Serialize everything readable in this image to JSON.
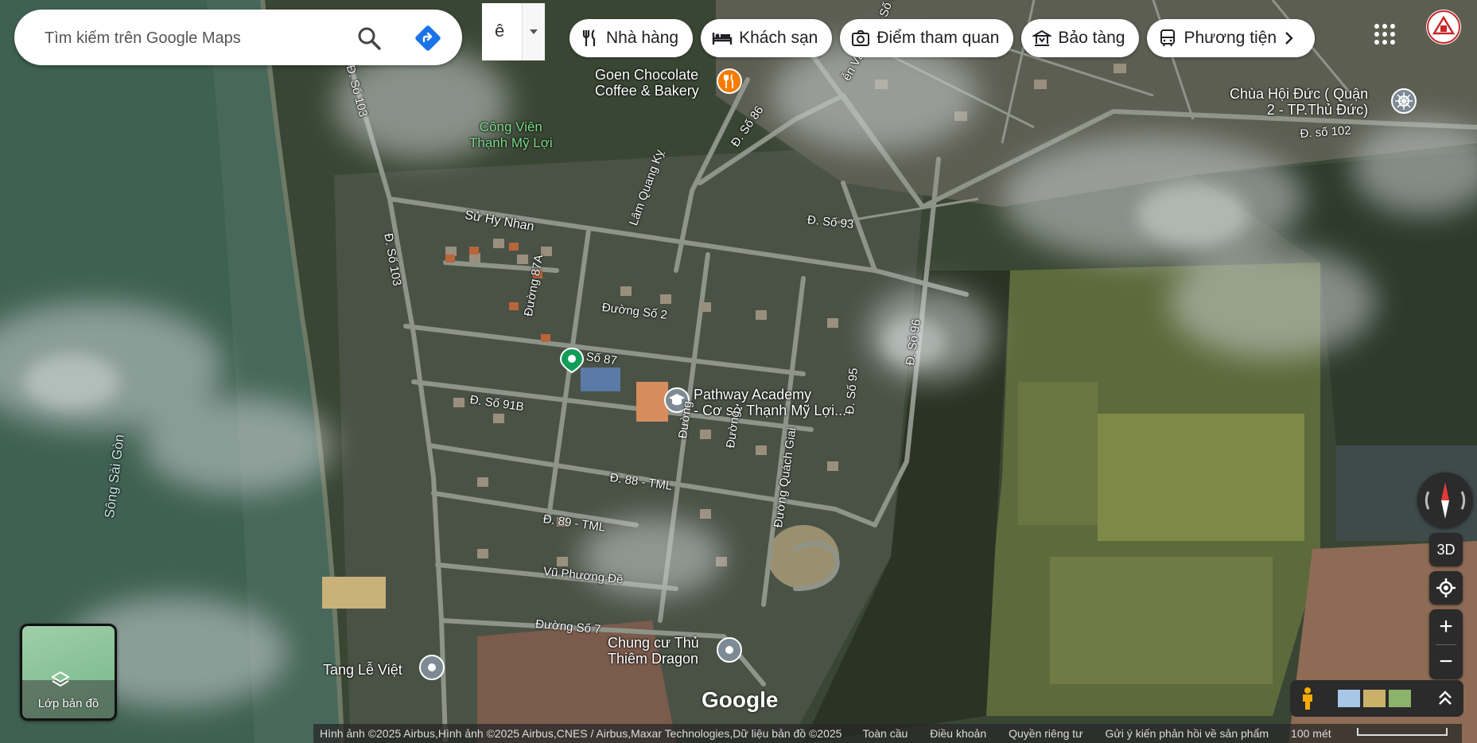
{
  "search": {
    "placeholder": "Tìm kiếm trên Google Maps"
  },
  "lang": {
    "char": "ê"
  },
  "chips": [
    {
      "label": "Nhà hàng",
      "icon": "fork-knife-icon"
    },
    {
      "label": "Khách sạn",
      "icon": "bed-icon"
    },
    {
      "label": "Điểm tham quan",
      "icon": "camera-icon"
    },
    {
      "label": "Bảo tàng",
      "icon": "museum-icon"
    },
    {
      "label": "Phương tiện",
      "icon": "transit-icon"
    }
  ],
  "map_labels": {
    "cong_vien": "Công Viên\nThạnh Mỹ Lợi",
    "goen": "Goen Chocolate\nCoffee & Bakery",
    "chua": "Chùa Hội Đức ( Quận\n2 - TP.Thủ Đức)",
    "pathway": "Pathway Academy\n- Cơ sở Thạnh Mỹ Lợi...",
    "chungcu": "Chung cư Thủ\nThiêm Dragon",
    "tangle": "Tang Lễ Việt",
    "song": "Sông Sài Gòn",
    "lam_quang_ky": "Lâm Quang Kỵ",
    "su_hy_nhan": "Sử Hy Nhan",
    "d_so_103a": "Đ. Số 103",
    "d_so_103b": "Đ. Số 103",
    "d_so_86": "Đ. Số 86",
    "d_so_93": "Đ. Số 93",
    "duong_so_2": "Đường Số 2",
    "duong_87a": "Đường 87A",
    "so_87": "Số 87",
    "d_so_91b": "Đ. Số 91B",
    "d_so_95": "Đ. Số 95",
    "d_so_96": "Đ. Số 96",
    "d_88": "Đ. 88 - TML",
    "d_89": "Đ. 89 - TML",
    "vu_phuong_de": "Vũ Phương Đề",
    "duong_so_7": "Đường Số 7",
    "duong_quach_giai": "Đường Quách Giai",
    "d_so_102": "Đ. số 102",
    "nguyen_van_kinh": "ễn Văn Kính",
    "d_so_top": "Đ. Số 9",
    "duong_a": "Đường",
    "duong_b": "Đường"
  },
  "controls": {
    "three_d": "3D",
    "zoom_in": "+",
    "zoom_out": "−"
  },
  "layers": {
    "label": "Lớp bản đồ"
  },
  "google": "Google",
  "footer": {
    "imagery": "Hình ảnh ©2025 Airbus,Hình ảnh ©2025 Airbus,CNES / Airbus,Maxar Technologies,Dữ liệu bản đồ ©2025",
    "global": "Toàn cầu",
    "terms": "Điều khoản",
    "privacy": "Quyền riêng tư",
    "feedback": "Gửi ý kiến phản hồi về sản phẩm",
    "scale": "100 mét"
  },
  "colors": {
    "accent_blue": "#1a73e8",
    "poi_orange": "#f57c00",
    "poi_green": "#0f9d58",
    "poi_gray": "#7d8a93"
  }
}
